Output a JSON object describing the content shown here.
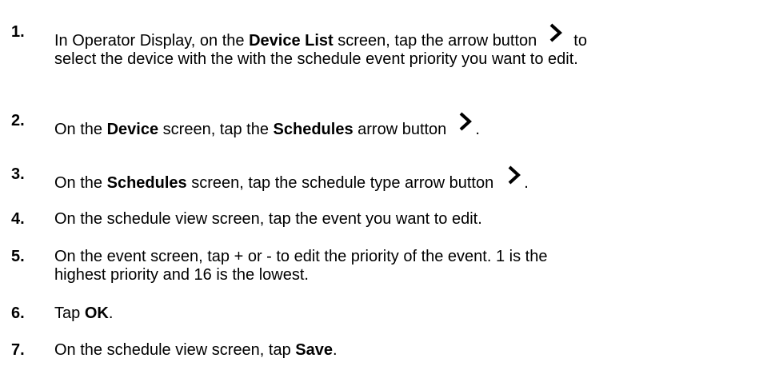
{
  "icons": {
    "arrow": "chevron-right-icon"
  },
  "steps": [
    {
      "num": "1.",
      "t1": "In Operator Display, on the ",
      "b1": "Device List",
      "t2": " screen, tap the arrow button",
      "t3": "to",
      "line2": "select the device with the with the schedule event priority you want to edit."
    },
    {
      "num": "2.",
      "t1": "On the ",
      "b1": "Device",
      "t2": " screen, tap the ",
      "b2": "Schedules",
      "t3": " arrow button",
      "t4": "."
    },
    {
      "num": "3.",
      "t1": "On the ",
      "b1": "Schedules",
      "t2": " screen, tap the schedule type arrow button",
      "t3": "."
    },
    {
      "num": "4.",
      "t1": "On the schedule view screen, tap the event you want to edit."
    },
    {
      "num": "5.",
      "t1": "On the event screen, tap + or - to edit the priority of the event. 1 is the",
      "line2": "highest priority and 16 is the lowest."
    },
    {
      "num": "6.",
      "t1": "Tap ",
      "b1": "OK",
      "t2": "."
    },
    {
      "num": "7.",
      "t1": "On the schedule view screen, tap ",
      "b1": "Save",
      "t2": "."
    }
  ]
}
